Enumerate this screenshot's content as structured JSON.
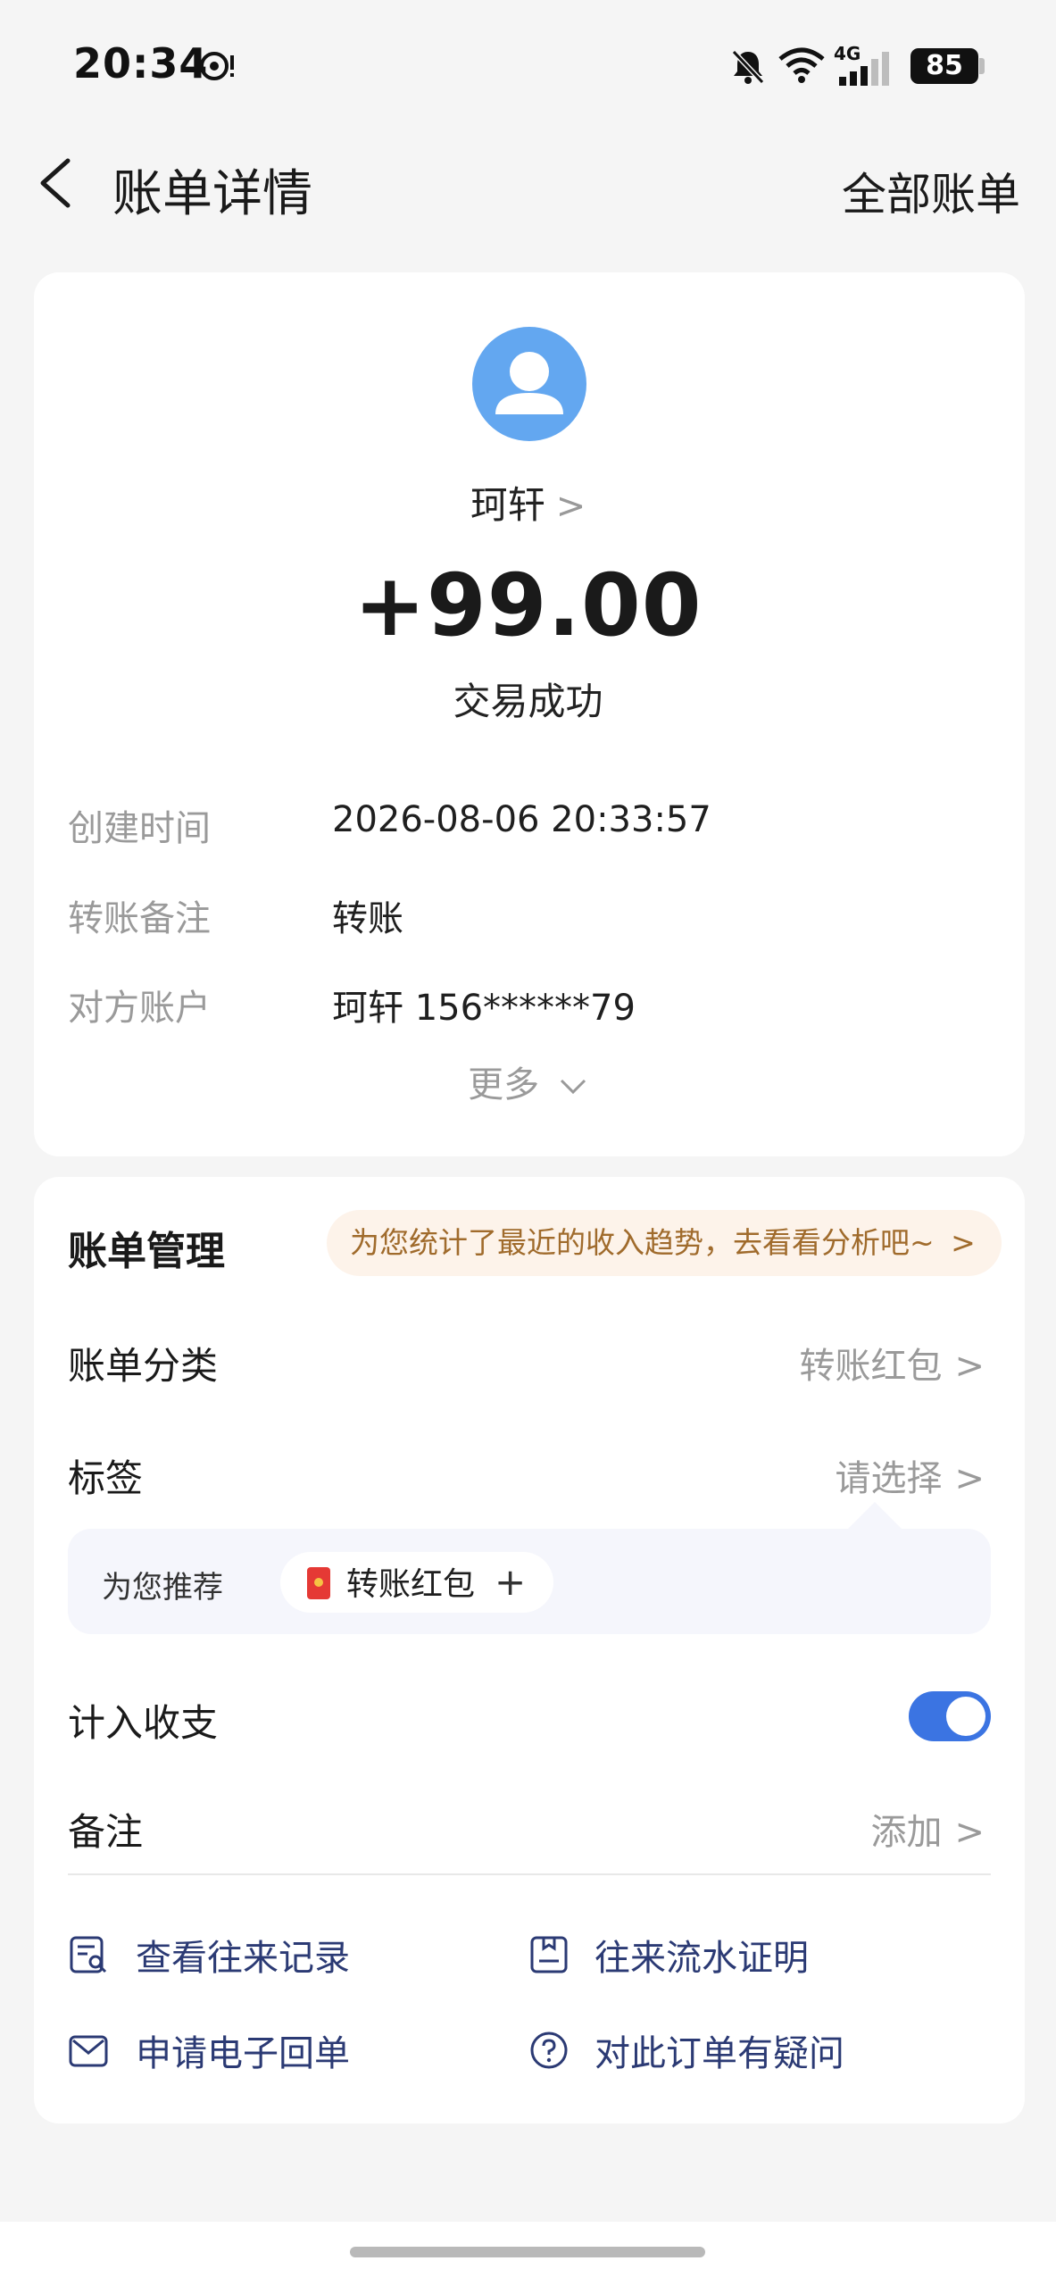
{
  "status_bar": {
    "time": "20:34",
    "network": "4G",
    "battery": "85"
  },
  "header": {
    "title": "账单详情",
    "right_link": "全部账单"
  },
  "transaction": {
    "counterparty": "珂轩",
    "amount": "+99.00",
    "status": "交易成功",
    "details": [
      {
        "label": "创建时间",
        "value": "2026-08-06 20:33:57"
      },
      {
        "label": "转账备注",
        "value": "转账"
      },
      {
        "label": "对方账户",
        "value": "珂轩 156******79"
      }
    ],
    "more": "更多"
  },
  "management": {
    "title": "账单管理",
    "promo": "为您统计了最近的收入趋势，去看看分析吧~",
    "category_label": "账单分类",
    "category_value": "转账红包",
    "tag_label": "标签",
    "tag_value": "请选择",
    "recommend_label": "为您推荐",
    "recommend_tag": "转账红包",
    "include_label": "计入收支",
    "include_enabled": true,
    "note_label": "备注",
    "note_value": "添加"
  },
  "actions": [
    {
      "label": "查看往来记录",
      "icon": "record-search-icon"
    },
    {
      "label": "往来流水证明",
      "icon": "certificate-icon"
    },
    {
      "label": "申请电子回单",
      "icon": "mail-icon"
    },
    {
      "label": "对此订单有疑问",
      "icon": "question-icon"
    }
  ],
  "colors": {
    "accent": "#3b74e2",
    "avatar": "#63a7f0",
    "promo_bg": "#fdf3ea",
    "promo_text": "#a06b2c",
    "action_text": "#2b3a74"
  }
}
